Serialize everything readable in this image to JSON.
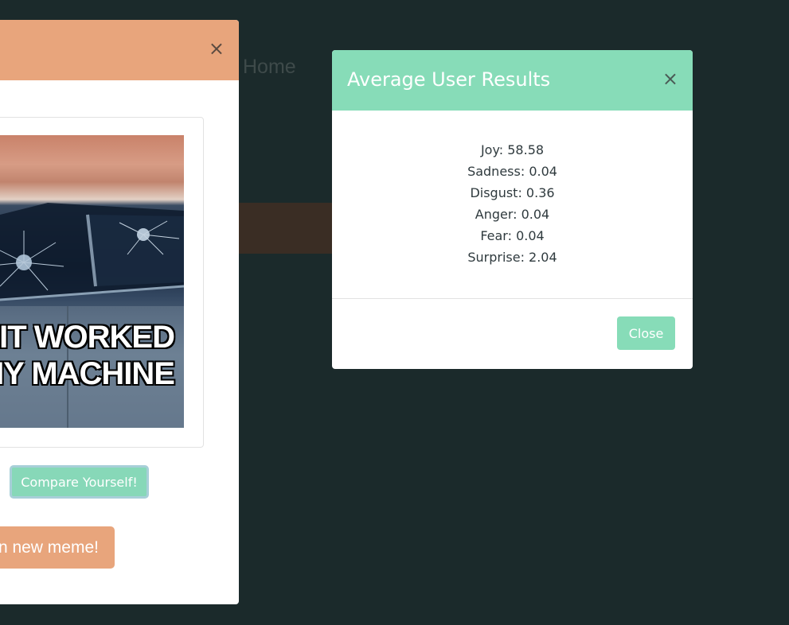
{
  "background": {
    "nav_link": "Home"
  },
  "left_modal": {
    "close_symbol": "×",
    "meme": {
      "caption_line_1": "IT WORKED",
      "caption_line_2": "MY MACHINE"
    },
    "compare_button": "Compare Yourself!",
    "new_meme_button": "n new meme!"
  },
  "results_modal": {
    "title": "Average User Results",
    "close_symbol": "×",
    "results": [
      "Joy: 58.58",
      "Sadness: 0.04",
      "Disgust: 0.36",
      "Anger: 0.04",
      "Fear: 0.04",
      "Surprise: 2.04"
    ],
    "close_button": "Close"
  },
  "colors": {
    "page_background": "#1b2a2b",
    "accent_orange": "#e8a57c",
    "accent_green": "#87dcb8"
  }
}
